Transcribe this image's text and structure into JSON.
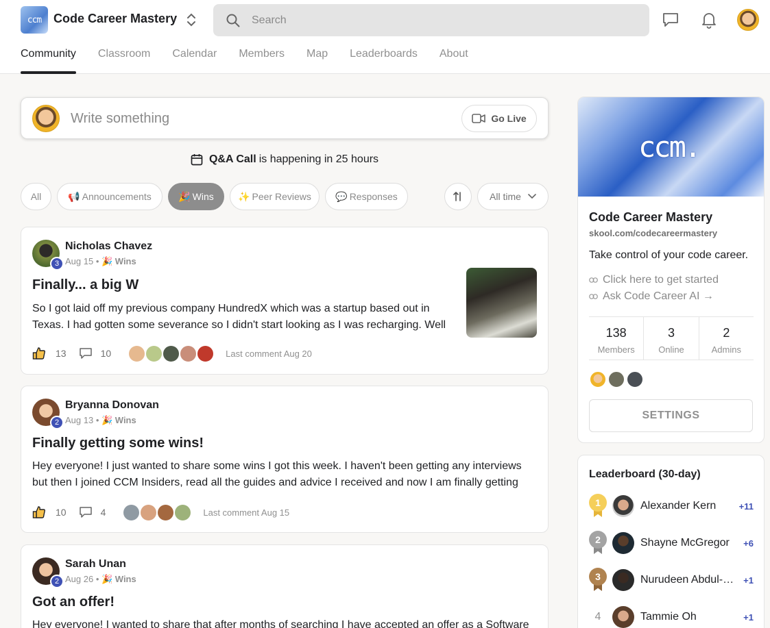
{
  "header": {
    "brand": "Code Career Mastery",
    "logo_text": "ccm",
    "search_placeholder": "Search"
  },
  "nav": {
    "tabs": [
      {
        "label": "Community",
        "active": true
      },
      {
        "label": "Classroom"
      },
      {
        "label": "Calendar"
      },
      {
        "label": "Members"
      },
      {
        "label": "Map"
      },
      {
        "label": "Leaderboards"
      },
      {
        "label": "About"
      }
    ]
  },
  "composer": {
    "placeholder": "Write something",
    "go_live": "Go Live"
  },
  "event": {
    "name": "Q&A Call",
    "text": "is happening in 25 hours"
  },
  "filters": {
    "chips": [
      "All",
      "Announcements",
      "Wins",
      "Peer Reviews",
      "Responses"
    ],
    "chip_emojis": [
      "",
      "📢",
      "🎉",
      "✨",
      "💬"
    ],
    "sort": "All time"
  },
  "posts": [
    {
      "author": "Nicholas Chavez",
      "level": "3",
      "date": "Aug 15",
      "category": "🎉 Wins",
      "title": "Finally... a big W",
      "body": "So I got laid off my previous company HundredX which was a startup based out in Texas. I had gotten some severance so I didn't start looking as I was recharging. Well",
      "likes": "13",
      "comments": "10",
      "last_comment": "Last comment Aug 20"
    },
    {
      "author": "Bryanna Donovan",
      "level": "2",
      "date": "Aug 13",
      "category": "🎉 Wins",
      "title": "Finally getting some wins!",
      "body": "Hey everyone! I just wanted to share some wins I got this week. I haven't been getting any interviews but then I joined CCM Insiders, read all the guides and advice I received and now I am finally getting",
      "likes": "10",
      "comments": "4",
      "last_comment": "Last comment Aug 15"
    },
    {
      "author": "Sarah Unan",
      "level": "2",
      "date": "Aug 26",
      "category": "🎉 Wins",
      "title": "Got an offer!",
      "body": "Hey everyone! I wanted to share that after months of searching I have accepted an offer as a Software"
    }
  ],
  "group": {
    "cover_text": "ccm.",
    "name": "Code Career Mastery",
    "url": "skool.com/codecareermastery",
    "description": "Take control of your code career.",
    "links": [
      "Click here to get started",
      "Ask Code Career AI →"
    ],
    "stats": [
      {
        "value": "138",
        "label": "Members"
      },
      {
        "value": "3",
        "label": "Online"
      },
      {
        "value": "2",
        "label": "Admins"
      }
    ],
    "settings": "SETTINGS"
  },
  "leaderboard": {
    "title": "Leaderboard (30-day)",
    "rows": [
      {
        "rank": "1",
        "name": "Alexander Kern",
        "points": "+11"
      },
      {
        "rank": "2",
        "name": "Shayne McGregor",
        "points": "+6"
      },
      {
        "rank": "3",
        "name": "Nurudeen Abdul-Kareem",
        "points": "+1"
      },
      {
        "rank": "4",
        "name": "Tammie Oh",
        "points": "+1"
      }
    ]
  },
  "colors": {
    "accent": "#3f51b5",
    "active_chip": "#8d8d8d",
    "gold": "#f2c94c",
    "silver": "#9e9e9e",
    "bronze": "#a87c4f"
  }
}
